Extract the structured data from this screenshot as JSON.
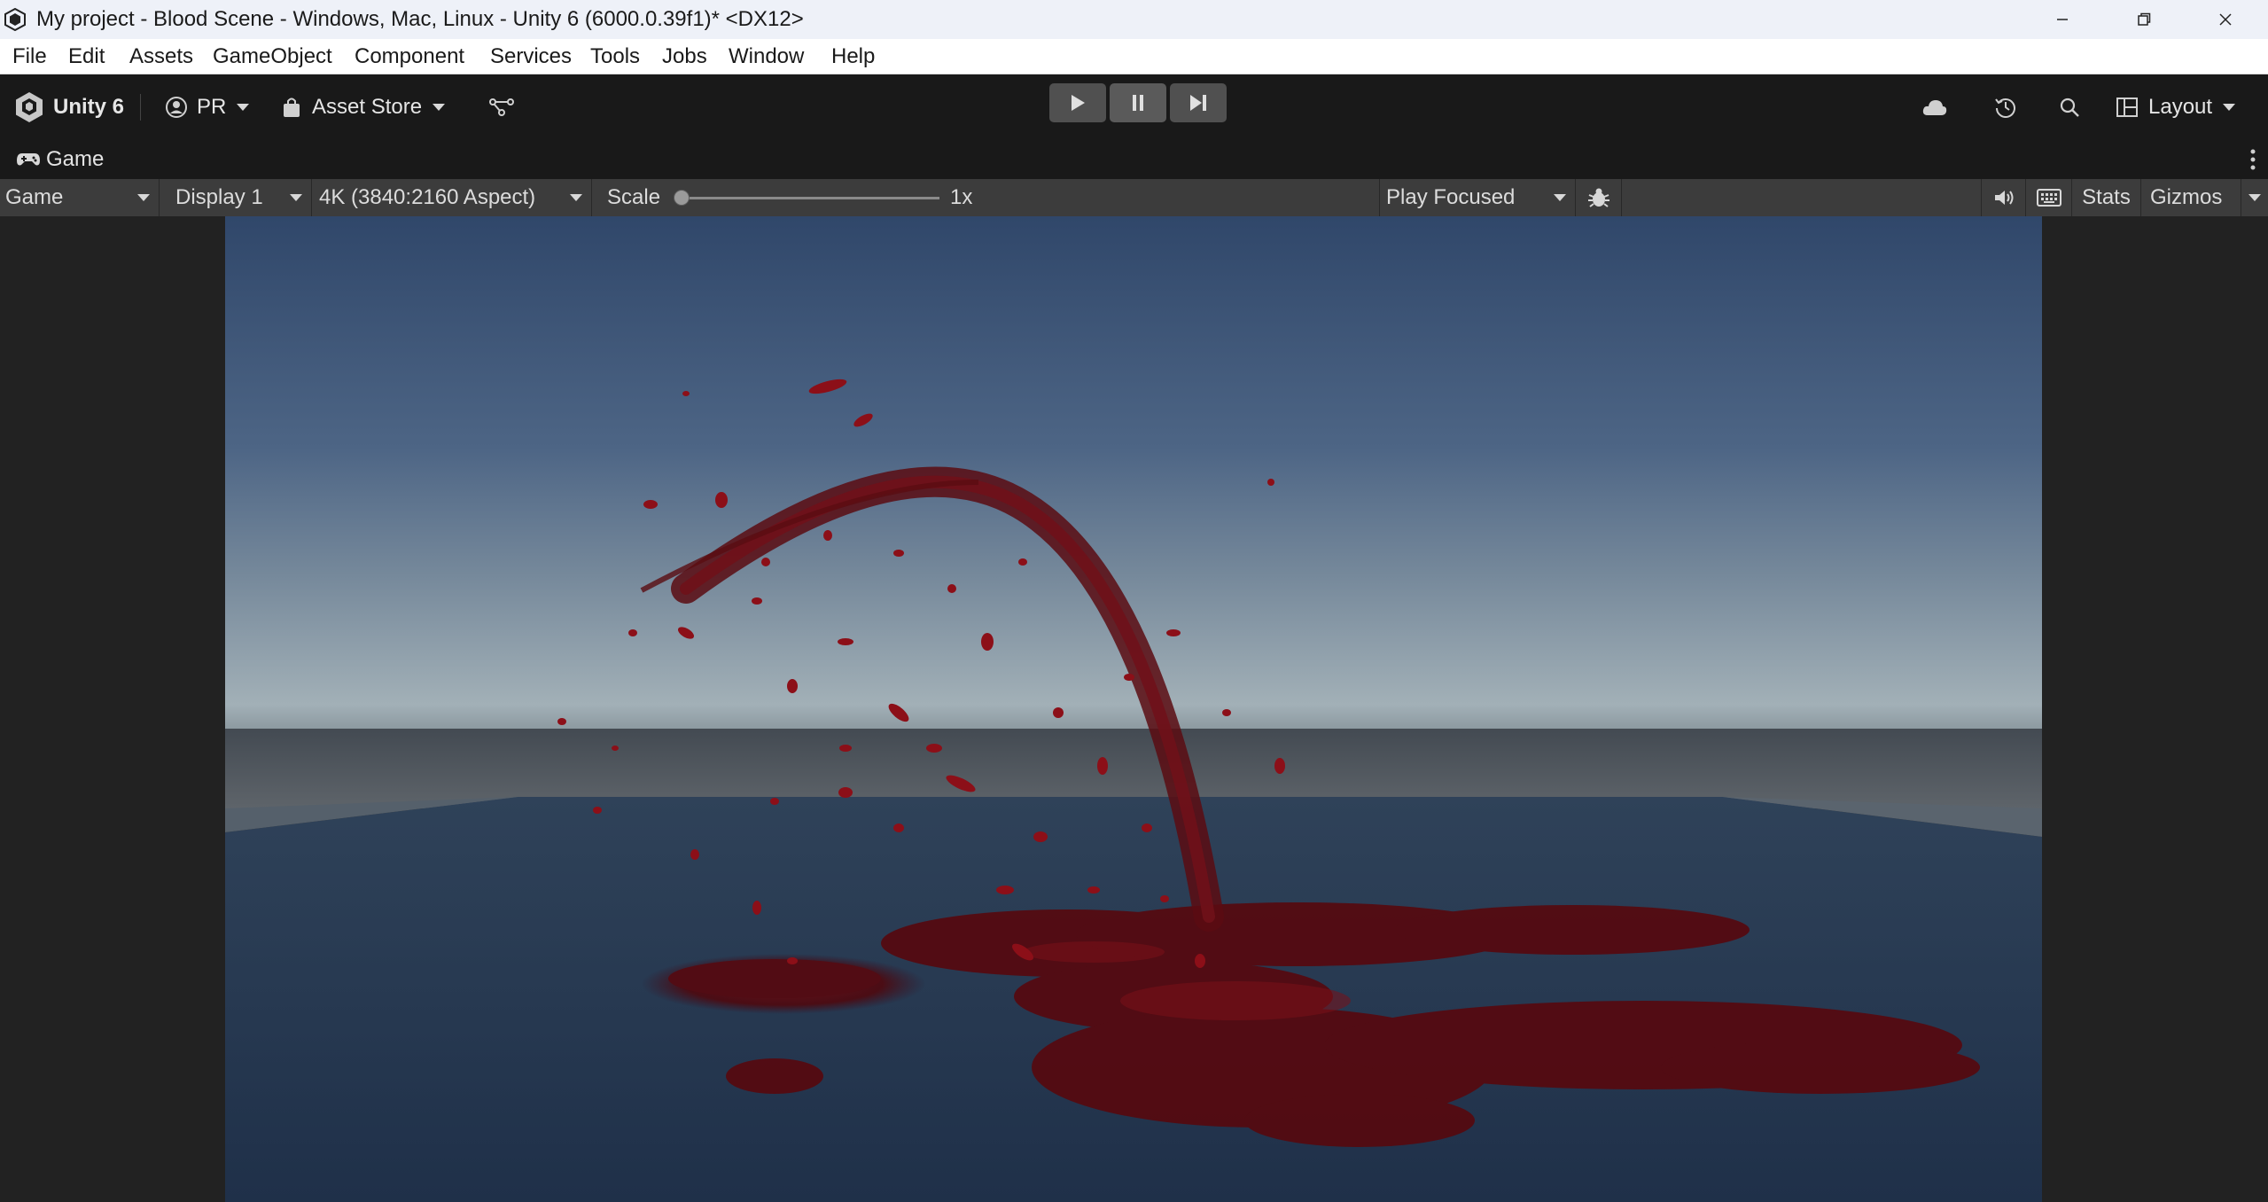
{
  "window": {
    "title": "My project - Blood Scene - Windows, Mac, Linux - Unity 6 (6000.0.39f1)* <DX12>",
    "controls": [
      "minimize-icon",
      "restore-icon",
      "close-icon"
    ]
  },
  "menu": {
    "items": [
      "File",
      "Edit",
      "Assets",
      "GameObject",
      "Component",
      "Services",
      "Tools",
      "Jobs",
      "Window",
      "Help"
    ]
  },
  "toolbar": {
    "brand": "Unity 6",
    "account": "PR",
    "asset_store": "Asset Store",
    "layout": "Layout",
    "icons": [
      "unity-logo-icon",
      "account-icon",
      "asset-store-bag-icon",
      "version-control-icon",
      "play-icon",
      "pause-icon",
      "step-icon",
      "cloud-icon",
      "history-icon",
      "search-icon",
      "layout-icon"
    ]
  },
  "game_tab": {
    "label": "Game"
  },
  "game_view": {
    "mode": "Game",
    "display": "Display 1",
    "aspect": "4K (3840:2160 Aspect)",
    "scale_label": "Scale",
    "scale_value": "1x",
    "scale_slider_fraction": 0,
    "play_mode": "Play Focused",
    "stats": "Stats",
    "gizmos": "Gizmos"
  },
  "colors": {
    "os_titlebar": "#eef1f8",
    "editor_toolbar": "#191919",
    "gameview_toolbar": "#3c3c3c",
    "sky_top": "#2f4566",
    "horizon": "#9aa8b1",
    "ground": "#28384f",
    "blood": "#5c0a10"
  }
}
